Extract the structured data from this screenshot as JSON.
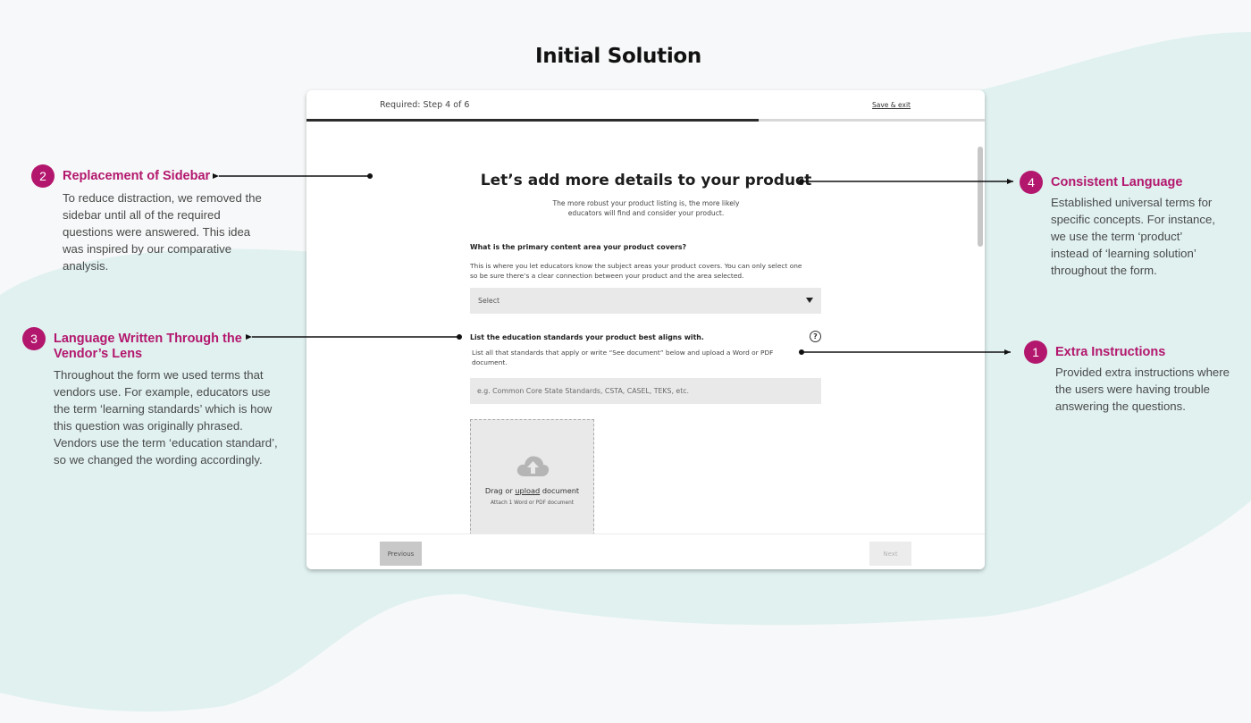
{
  "page": {
    "title": "Initial Solution"
  },
  "colors": {
    "accent": "#b3176d",
    "background_blob": "#e0f1f0",
    "progress": "#2b2b2b"
  },
  "form": {
    "step_text": "Required:  Step 4 of 6",
    "save_exit": "Save & exit",
    "progress_fraction": 0.667,
    "heading": "Let’s add more details to your product",
    "subheading_line1": "The more robust your product listing is, the more likely",
    "subheading_line2": "educators will find and consider your product.",
    "q1_label": "What is the primary content area your product covers?",
    "q1_help_line1": "This is where you let educators know the subject areas your product covers. You can only select one",
    "q1_help_line2": "so be sure there’s a clear connection between your product and the area selected.",
    "q1_select_value": "Select",
    "q2_label": "List the education standards your product best aligns with.",
    "q2_help_line1": "List all that standards that apply or write “See document” below and upload a Word or PDF",
    "q2_help_line2": "document.",
    "q2_placeholder": "e.g. Common Core State Standards, CSTA, CASEL, TEKS, etc.",
    "help_icon_glyph": "?",
    "upload_drag": "Drag or ",
    "upload_link": "upload",
    "upload_doc": " document",
    "upload_sub": "Attach 1 Word or PDF document",
    "upload_icon": "cloud-upload-icon",
    "btn_previous": "Previous",
    "btn_next": "Next"
  },
  "callouts": {
    "c2": {
      "number": "2",
      "title": "Replacement of Sidebar",
      "body": [
        "To reduce distraction, we removed the",
        "sidebar until all of the required",
        "questions were answered.  This idea",
        "was inspired by our comparative",
        "analysis."
      ]
    },
    "c3": {
      "number": "3",
      "title_line1": "Language Written Through the",
      "title_line2": "Vendor’s Lens",
      "body": [
        "Throughout the form we used terms that",
        "vendors use.  For example, educators use",
        "the term ‘learning standards’ which is how",
        "this question was originally phrased.",
        "Vendors use the term ‘education standard’,",
        "so we changed the wording accordingly."
      ]
    },
    "c4": {
      "number": "4",
      "title": "Consistent Language",
      "body": [
        "Established universal terms for",
        "specific concepts.  For instance,",
        "we use the term ‘product’",
        "instead of ‘learning solution’",
        "throughout the form."
      ]
    },
    "c1": {
      "number": "1",
      "title": "Extra Instructions",
      "body": [
        "Provided extra instructions where",
        "the users were having trouble",
        "answering the questions."
      ]
    }
  }
}
